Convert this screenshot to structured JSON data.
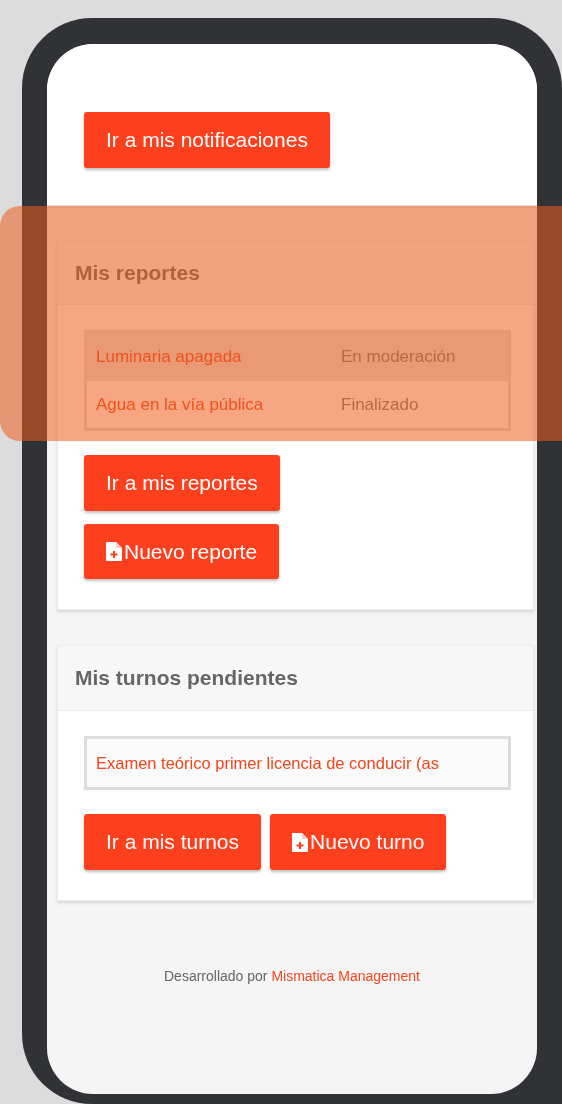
{
  "notifications": {
    "button": "Ir a mis notificaciones"
  },
  "reports": {
    "title": "Mis reportes",
    "highlighted": true,
    "rows": [
      {
        "name": "Luminaria apagada",
        "status": "En moderación",
        "striped": true
      },
      {
        "name": "Agua en la vía pública",
        "status": "Finalizado",
        "striped": false
      }
    ],
    "buttons": [
      {
        "label": "Ir a mis reportes",
        "kind": "link"
      },
      {
        "label": "Nuevo reporte",
        "kind": "new"
      }
    ]
  },
  "appointments": {
    "title": "Mis turnos pendientes",
    "items": [
      "Examen teórico primer licencia de conducir (as"
    ],
    "buttons": [
      {
        "label": "Ir a mis turnos",
        "kind": "link"
      },
      {
        "label": "Nuevo turno",
        "kind": "new"
      }
    ]
  },
  "footer": {
    "text": "Desarrollado por",
    "link": "Mismatica Management"
  }
}
